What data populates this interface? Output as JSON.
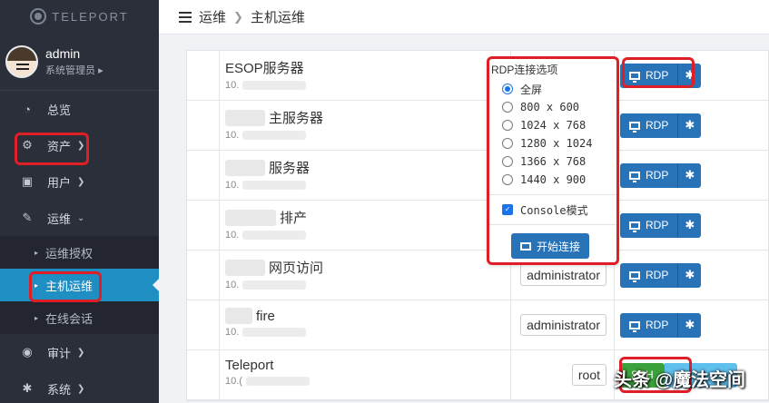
{
  "app": {
    "logo_text": "TELEPORT"
  },
  "user": {
    "name": "admin",
    "role": "系统管理员"
  },
  "sidebar": {
    "items": [
      {
        "label": "总览",
        "icon": "dashboard-icon"
      },
      {
        "label": "资产",
        "icon": "assets-icon"
      },
      {
        "label": "用户",
        "icon": "user-icon"
      },
      {
        "label": "运维",
        "icon": "wrench-icon"
      }
    ],
    "sub_items": [
      {
        "label": "运维授权"
      },
      {
        "label": "主机运维"
      },
      {
        "label": "在线会话"
      }
    ],
    "bottom_items": [
      {
        "label": "审计",
        "icon": "eye-icon"
      },
      {
        "label": "系统",
        "icon": "gear-icon"
      }
    ]
  },
  "header": {
    "section": "运维",
    "page": "主机运维"
  },
  "hosts": [
    {
      "name": "ESOP服务器",
      "ip": "10.",
      "account": "",
      "action": "RDP"
    },
    {
      "name": "主服务器",
      "ip": "10.",
      "account": "",
      "action": "RDP"
    },
    {
      "name": "服务器",
      "ip": "10.",
      "account": "",
      "action": "RDP"
    },
    {
      "name": "排产",
      "ip": "10.",
      "account": "",
      "action": "RDP"
    },
    {
      "name": "网页访问",
      "ip": "10.",
      "account": "administrator",
      "action": "RDP"
    },
    {
      "name": "fire",
      "ip": "10.",
      "account": "administrator",
      "action": "RDP"
    },
    {
      "name": "Teleport",
      "ip": "10.(",
      "account": "root",
      "action": "SSH"
    }
  ],
  "popup": {
    "title": "RDP连接选项",
    "options": [
      "全屏",
      "800 x 600",
      "1024 x 768",
      "1280 x 1024",
      "1366 x 768",
      "1440 x 900"
    ],
    "console_label": "Console模式",
    "connect_label": "开始连接"
  },
  "watermark": "头条 @魔法空间",
  "colors": {
    "accent": "#2873b8",
    "highlight": "#e01e26",
    "active_nav": "#1f8ec2"
  }
}
